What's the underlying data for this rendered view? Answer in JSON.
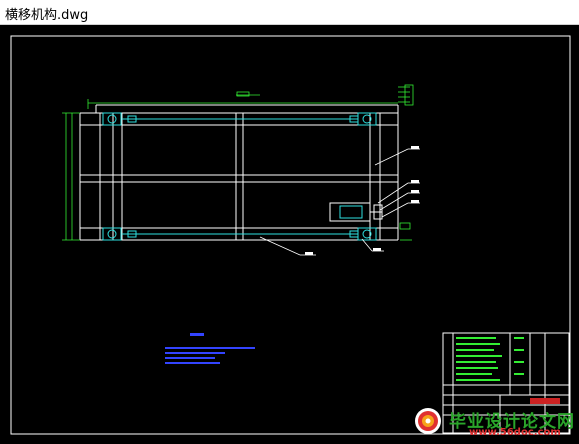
{
  "window": {
    "title": "横移机构.dwg"
  },
  "drawing": {
    "background_color": "#000000",
    "line_color_main": "#ffffff",
    "line_color_struct": "#2ee0e0",
    "line_color_dim": "#33ee33",
    "line_color_tech": "#3344ff",
    "notes": {
      "heading": "技术要求"
    }
  },
  "watermark": {
    "title": "毕业设计论文网",
    "url": "www.56doc.com"
  }
}
